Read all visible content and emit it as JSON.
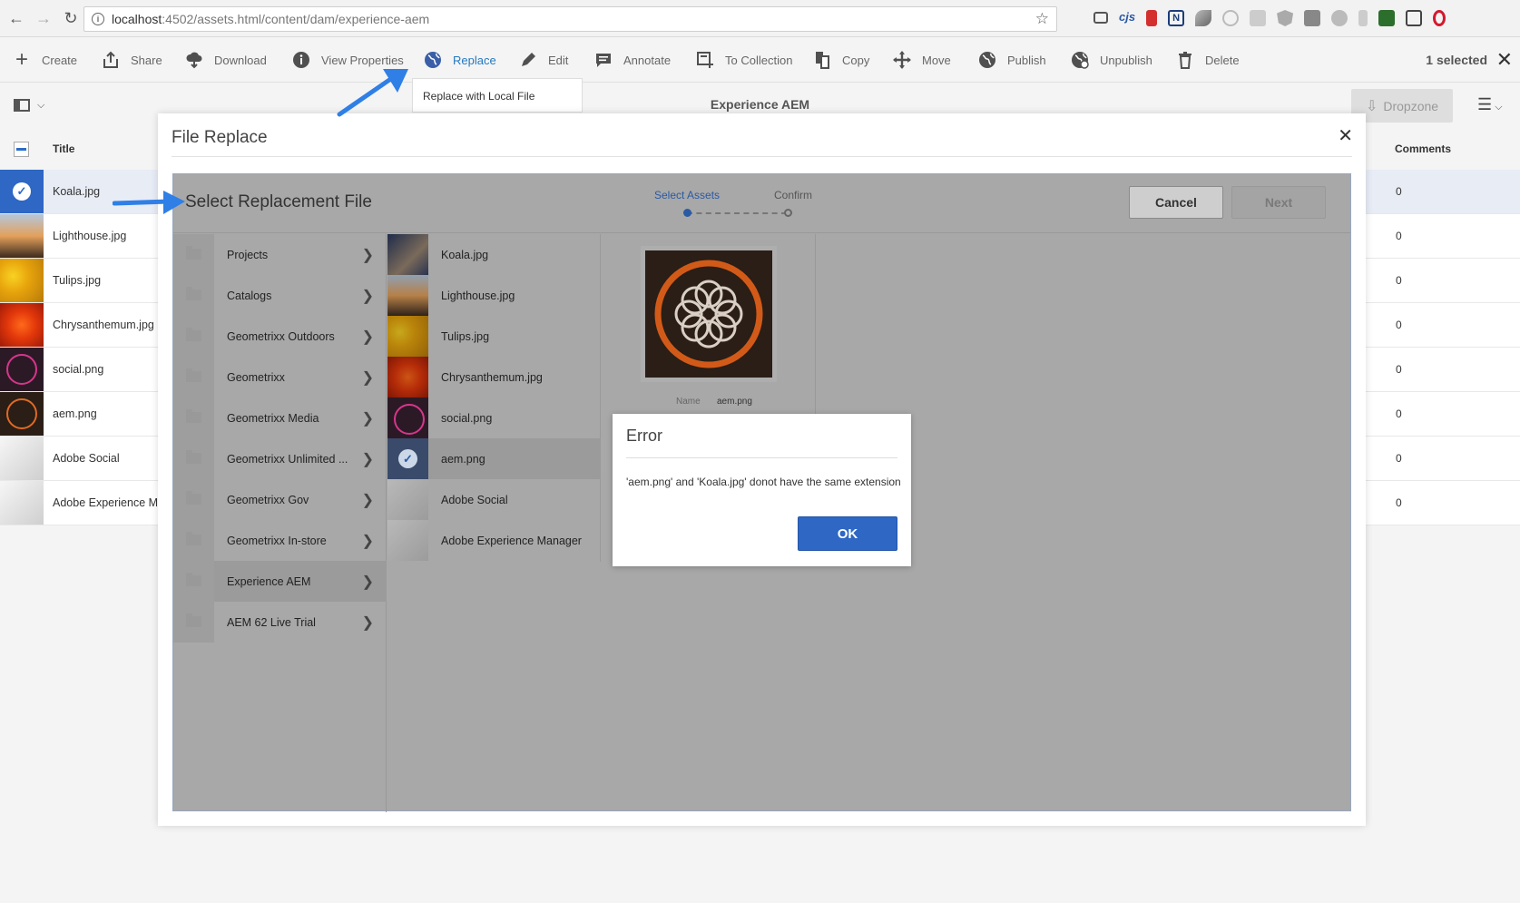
{
  "browser": {
    "url_host": "localhost",
    "url_path": ":4502/assets.html/content/dam/experience-aem"
  },
  "toolbar": {
    "actions": [
      {
        "label": "Create",
        "icon": "plus-icon"
      },
      {
        "label": "Share",
        "icon": "share-icon"
      },
      {
        "label": "Download",
        "icon": "download-icon"
      },
      {
        "label": "View Properties",
        "icon": "info-icon"
      },
      {
        "label": "Replace",
        "icon": "globe-icon"
      },
      {
        "label": "Edit",
        "icon": "pencil-icon"
      },
      {
        "label": "Annotate",
        "icon": "comment-icon"
      },
      {
        "label": "To Collection",
        "icon": "collection-icon"
      },
      {
        "label": "Copy",
        "icon": "copy-icon"
      },
      {
        "label": "Move",
        "icon": "move-icon"
      },
      {
        "label": "Publish",
        "icon": "globe-icon"
      },
      {
        "label": "Unpublish",
        "icon": "globe-icon"
      },
      {
        "label": "Delete",
        "icon": "trash-icon"
      }
    ],
    "selected_count": "1 selected",
    "replace_popover": "Replace with Local File"
  },
  "header": {
    "title": "Experience AEM",
    "dropzone": "Dropzone"
  },
  "list": {
    "col_title": "Title",
    "col_comments": "Comments",
    "rows": [
      {
        "name": "Koala.jpg",
        "comments": "0"
      },
      {
        "name": "Lighthouse.jpg",
        "comments": "0"
      },
      {
        "name": "Tulips.jpg",
        "comments": "0"
      },
      {
        "name": "Chrysanthemum.jpg",
        "comments": "0"
      },
      {
        "name": "social.png",
        "comments": "0"
      },
      {
        "name": "aem.png",
        "comments": "0"
      },
      {
        "name": "Adobe Social",
        "comments": "0"
      },
      {
        "name": "Adobe Experience Ma",
        "comments": "0"
      }
    ]
  },
  "modal": {
    "title": "File Replace",
    "wizard_title": "Select Replacement File",
    "step1": "Select Assets",
    "step2": "Confirm",
    "cancel": "Cancel",
    "next": "Next",
    "folders": [
      "Projects",
      "Catalogs",
      "Geometrixx Outdoors",
      "Geometrixx",
      "Geometrixx Media",
      "Geometrixx Unlimited ...",
      "Geometrixx Gov",
      "Geometrixx In-store",
      "Experience AEM",
      "AEM 62 Live Trial"
    ],
    "assets": [
      "Koala.jpg",
      "Lighthouse.jpg",
      "Tulips.jpg",
      "Chrysanthemum.jpg",
      "social.png",
      "aem.png",
      "Adobe Social",
      "Adobe Experience Manager"
    ],
    "preview_name_label": "Name",
    "preview_name_value": "aem.png"
  },
  "error": {
    "title": "Error",
    "message": "'aem.png' and 'Koala.jpg' donot have the same extension",
    "ok": "OK"
  },
  "colors": {
    "accent": "#2e67c4",
    "active_text": "#2479c1",
    "annotation_arrow": "#2f7fe6"
  }
}
